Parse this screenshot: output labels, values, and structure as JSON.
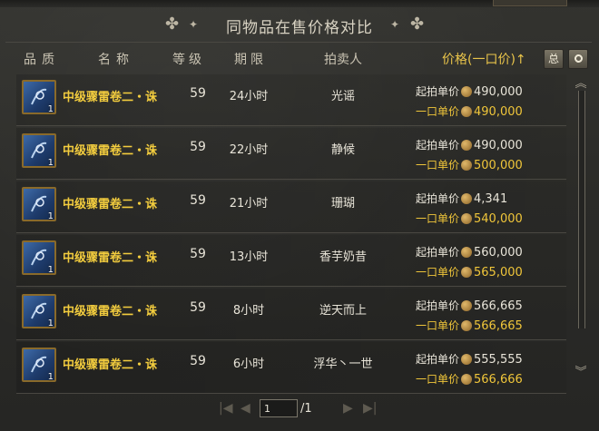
{
  "title": "同物品在售价格对比",
  "header": {
    "quality": "品质",
    "name": "名称",
    "level": "等级",
    "time": "期限",
    "seller": "拍卖人",
    "price": "价格(一口价)↑",
    "total_button": "总"
  },
  "price_labels": {
    "start": "起拍单价",
    "buyout": "一口单价"
  },
  "rows": [
    {
      "name": "中级骤雷卷二・诛",
      "count": "1",
      "level": "59",
      "time": "24小时",
      "seller": "光谣",
      "start": "490,000",
      "buyout": "490,000"
    },
    {
      "name": "中级骤雷卷二・诛",
      "count": "1",
      "level": "59",
      "time": "22小时",
      "seller": "静候",
      "start": "490,000",
      "buyout": "500,000"
    },
    {
      "name": "中级骤雷卷二・诛",
      "count": "1",
      "level": "59",
      "time": "21小时",
      "seller": "珊瑚",
      "start": "4,341",
      "buyout": "540,000"
    },
    {
      "name": "中级骤雷卷二・诛",
      "count": "1",
      "level": "59",
      "time": "13小时",
      "seller": "香芋奶昔",
      "start": "560,000",
      "buyout": "565,000"
    },
    {
      "name": "中级骤雷卷二・诛",
      "count": "1",
      "level": "59",
      "time": "8小时",
      "seller": "逆天而上",
      "start": "566,665",
      "buyout": "566,665"
    },
    {
      "name": "中级骤雷卷二・诛",
      "count": "1",
      "level": "59",
      "time": "6小时",
      "seller": "浮华丶一世",
      "start": "555,555",
      "buyout": "566,666"
    }
  ],
  "pager": {
    "current": "1",
    "total": "/1"
  },
  "colors": {
    "item_name": "#f2cc3e",
    "price_header": "#e9c44a",
    "buyout": "#f0c63a"
  },
  "icons": [
    "ornament-icon",
    "scroll-item-icon",
    "coin-icon",
    "chevron-up-icon",
    "chevron-down-icon",
    "first-page-icon",
    "prev-page-icon",
    "next-page-icon",
    "last-page-icon"
  ]
}
